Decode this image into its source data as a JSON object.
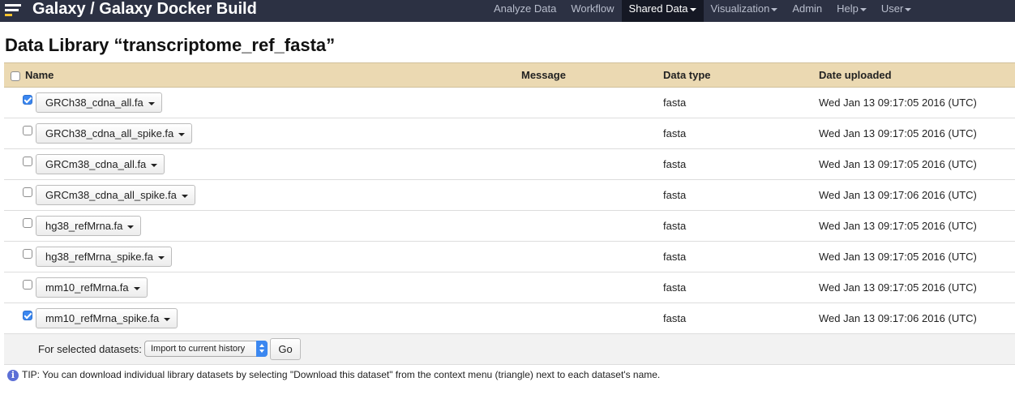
{
  "masthead": {
    "brand": "Galaxy / Galaxy Docker Build",
    "nav": [
      {
        "label": "Analyze Data",
        "dropdown": false,
        "active": false
      },
      {
        "label": "Workflow",
        "dropdown": false,
        "active": false
      },
      {
        "label": "Shared Data",
        "dropdown": true,
        "active": true
      },
      {
        "label": "Visualization",
        "dropdown": true,
        "active": false
      },
      {
        "label": "Admin",
        "dropdown": false,
        "active": false
      },
      {
        "label": "Help",
        "dropdown": true,
        "active": false
      },
      {
        "label": "User",
        "dropdown": true,
        "active": false
      }
    ]
  },
  "page": {
    "title": "Data Library “transcriptome_ref_fasta”"
  },
  "table": {
    "headers": {
      "name": "Name",
      "message": "Message",
      "data_type": "Data type",
      "date_uploaded": "Date uploaded"
    },
    "select_all_checked": false,
    "rows": [
      {
        "name": "GRCh38_cdna_all.fa",
        "message": "",
        "data_type": "fasta",
        "date": "Wed Jan 13 09:17:05 2016 (UTC)",
        "checked": true
      },
      {
        "name": "GRCh38_cdna_all_spike.fa",
        "message": "",
        "data_type": "fasta",
        "date": "Wed Jan 13 09:17:05 2016 (UTC)",
        "checked": false
      },
      {
        "name": "GRCm38_cdna_all.fa",
        "message": "",
        "data_type": "fasta",
        "date": "Wed Jan 13 09:17:05 2016 (UTC)",
        "checked": false
      },
      {
        "name": "GRCm38_cdna_all_spike.fa",
        "message": "",
        "data_type": "fasta",
        "date": "Wed Jan 13 09:17:06 2016 (UTC)",
        "checked": false
      },
      {
        "name": "hg38_refMrna.fa",
        "message": "",
        "data_type": "fasta",
        "date": "Wed Jan 13 09:17:05 2016 (UTC)",
        "checked": false
      },
      {
        "name": "hg38_refMrna_spike.fa",
        "message": "",
        "data_type": "fasta",
        "date": "Wed Jan 13 09:17:05 2016 (UTC)",
        "checked": false
      },
      {
        "name": "mm10_refMrna.fa",
        "message": "",
        "data_type": "fasta",
        "date": "Wed Jan 13 09:17:05 2016 (UTC)",
        "checked": false
      },
      {
        "name": "mm10_refMrna_spike.fa",
        "message": "",
        "data_type": "fasta",
        "date": "Wed Jan 13 09:17:06 2016 (UTC)",
        "checked": true
      }
    ]
  },
  "actions": {
    "label": "For selected datasets:",
    "selected_option": "Import to current history",
    "go_label": "Go"
  },
  "tip": {
    "icon": "info-icon",
    "text": "TIP: You can download individual library datasets by selecting \"Download this dataset\" from the context menu (triangle) next to each dataset's name."
  },
  "colors": {
    "masthead_bg": "#2c3143",
    "active_nav_bg": "#151824",
    "header_row_bg": "#ebd9b2",
    "logo_accent": "#f6c22d",
    "checkbox_checked": "#3b87f0",
    "info_icon": "#5c6fd6"
  }
}
